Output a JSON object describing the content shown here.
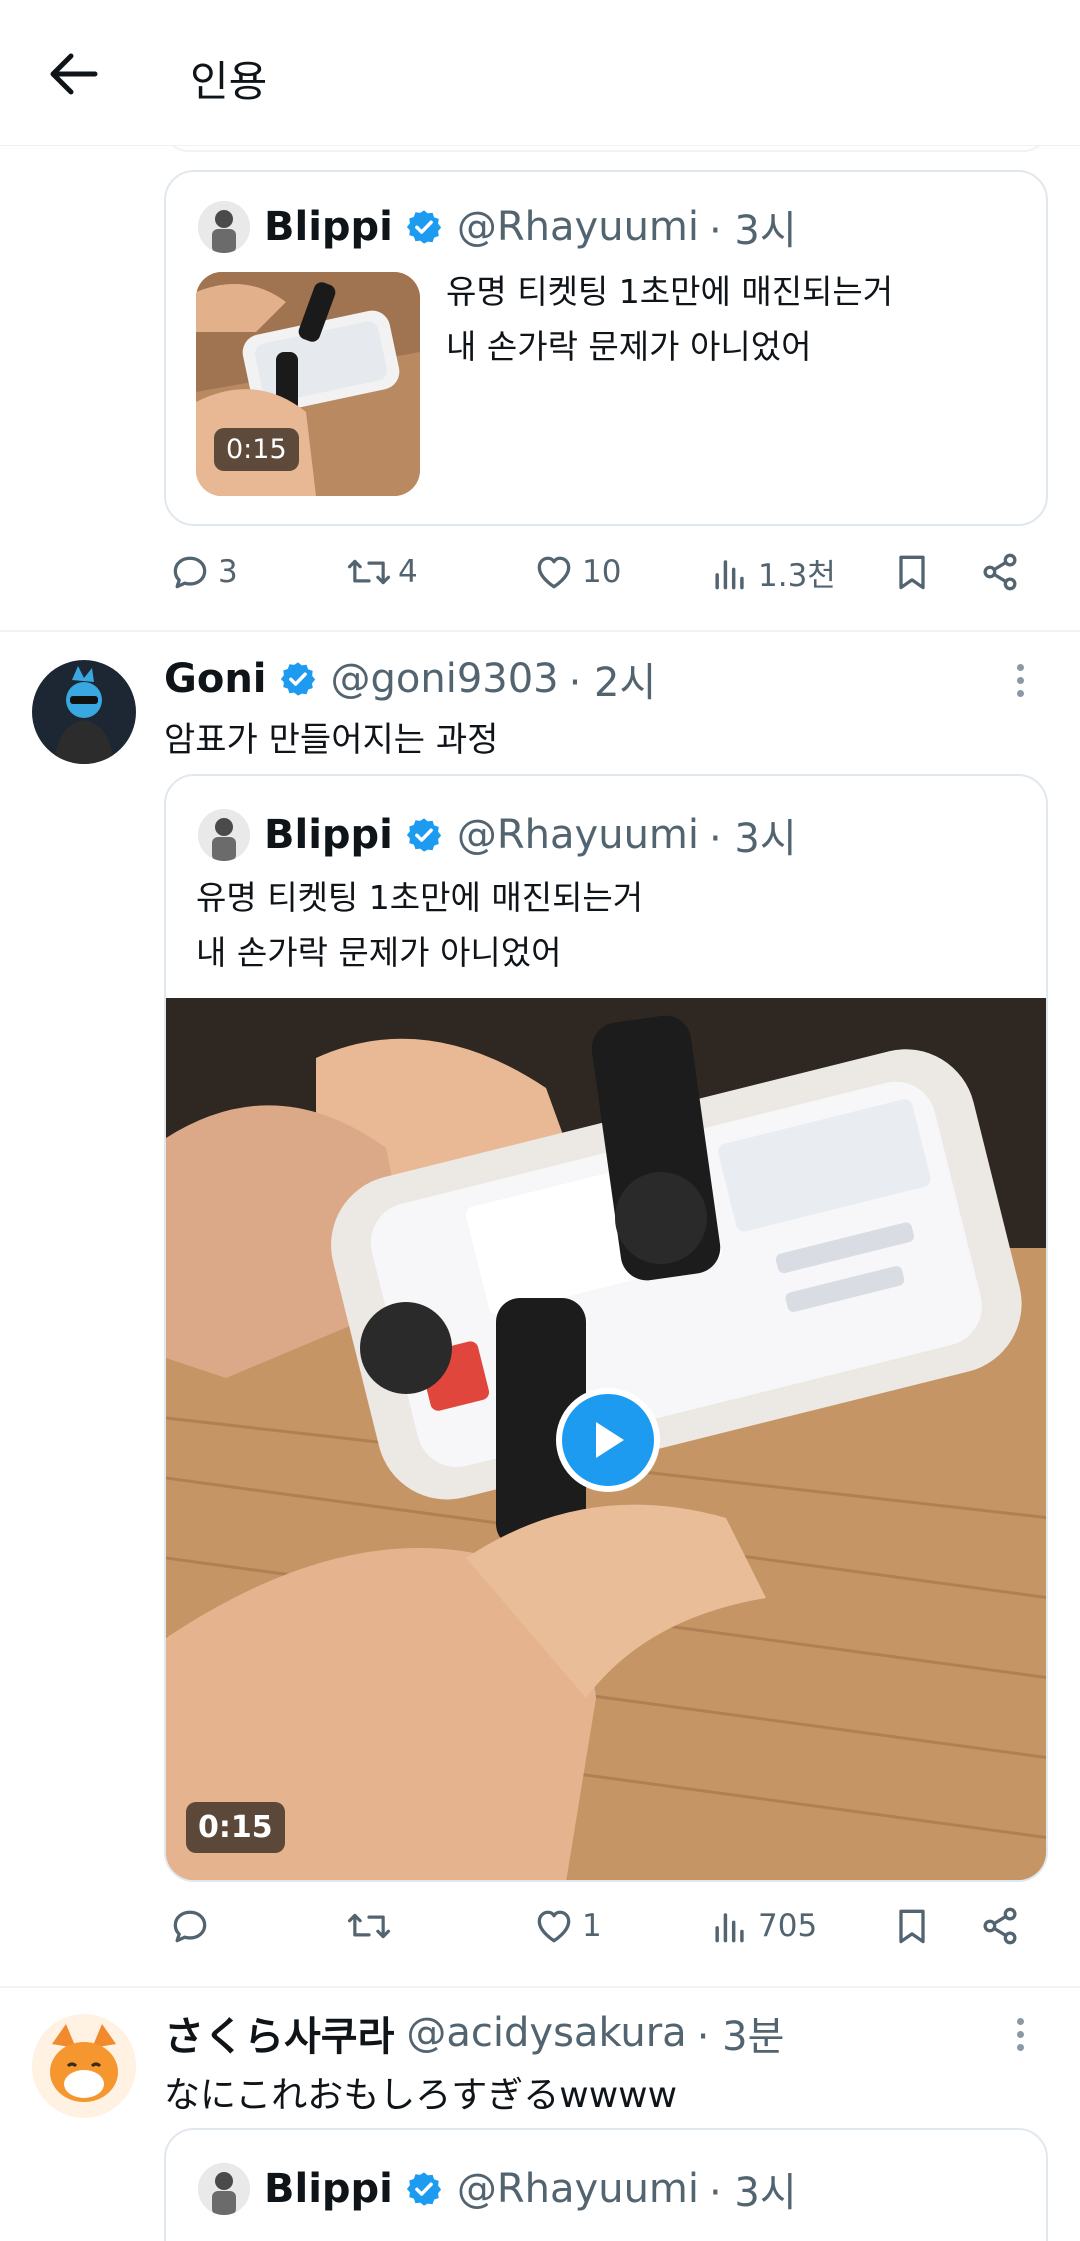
{
  "header": {
    "title": "인용"
  },
  "tweets": [
    {
      "quote": {
        "name": "Blippi",
        "handle": "@Rhayuumi",
        "time": "· 3시",
        "text": "유명 티켓팅 1초만에 매진되는거\n내 손가락 문제가 아니었어",
        "video_duration": "0:15"
      },
      "stats": {
        "replies": "3",
        "retweets": "4",
        "likes": "10",
        "views": "1.3천"
      }
    },
    {
      "name": "Goni",
      "handle": "@goni9303",
      "time": "· 2시",
      "text": "암표가 만들어지는 과정",
      "quote": {
        "name": "Blippi",
        "handle": "@Rhayuumi",
        "time": "· 3시",
        "text": "유명 티켓팅 1초만에 매진되는거\n내 손가락 문제가 아니었어",
        "video_duration": "0:15"
      },
      "stats": {
        "replies": "",
        "retweets": "",
        "likes": "1",
        "views": "705"
      }
    },
    {
      "name": "さくら사쿠라",
      "handle": "@acidysakura",
      "time": "· 3분",
      "text": "なにこれおもしろすぎるwwww",
      "quote": {
        "name": "Blippi",
        "handle": "@Rhayuumi",
        "time": "· 3시"
      }
    }
  ],
  "colors": {
    "accent": "#1d9bf0",
    "text": "#0f1419",
    "secondary": "#536471",
    "border": "#eff3f4"
  },
  "icons": [
    "back-arrow-icon",
    "verified-badge-icon",
    "reply-icon",
    "retweet-icon",
    "like-icon",
    "views-icon",
    "bookmark-icon",
    "share-icon",
    "more-icon",
    "play-icon"
  ]
}
